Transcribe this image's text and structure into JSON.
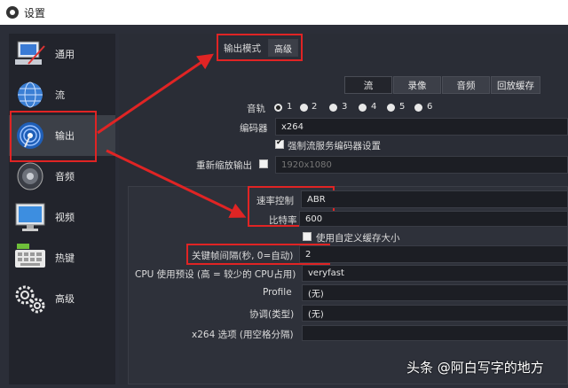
{
  "window": {
    "title": "设置"
  },
  "sidebar": {
    "items": [
      {
        "label": "通用",
        "icon": "general-icon"
      },
      {
        "label": "流",
        "icon": "stream-globe-icon"
      },
      {
        "label": "输出",
        "icon": "output-icon"
      },
      {
        "label": "音频",
        "icon": "speaker-icon"
      },
      {
        "label": "视频",
        "icon": "monitor-icon"
      },
      {
        "label": "热键",
        "icon": "keyboard-icon"
      },
      {
        "label": "高级",
        "icon": "gears-icon"
      }
    ],
    "active": "输出"
  },
  "output_mode": {
    "label": "输出模式",
    "value": "高级"
  },
  "tabs": [
    {
      "label": "流",
      "active": true
    },
    {
      "label": "录像",
      "active": false
    },
    {
      "label": "音频",
      "active": false
    },
    {
      "label": "回放缓存",
      "active": false
    }
  ],
  "audio_track": {
    "label": "音轨",
    "options": [
      "1",
      "2",
      "3",
      "4",
      "5",
      "6"
    ],
    "selected": "1"
  },
  "encoder": {
    "label": "编码器",
    "value": "x264"
  },
  "enforce_service_settings": {
    "label": "强制流服务编码器设置",
    "checked": true
  },
  "rescale_output": {
    "label": "重新缩放输出",
    "checked": false,
    "value": "1920x1080"
  },
  "rate_control": {
    "label": "速率控制",
    "value": "ABR"
  },
  "bitrate": {
    "label": "比特率",
    "value": "600"
  },
  "custom_buffer": {
    "label": "使用自定义缓存大小",
    "checked": false
  },
  "keyframe_interval": {
    "label": "关键帧间隔(秒, 0=自动)",
    "value": "2"
  },
  "cpu_preset": {
    "label": "CPU 使用预设 (高 = 较少的 CPU占用)",
    "value": "veryfast"
  },
  "profile": {
    "label": "Profile",
    "value": "(无)"
  },
  "tune": {
    "label": "协调(类型)",
    "value": "(无)"
  },
  "x264_options": {
    "label": "x264 选项 (用空格分隔)",
    "value": ""
  },
  "watermark": {
    "text": "头条 @阿白写字的地方"
  },
  "colors": {
    "annotation_red": "#e02424",
    "bg": "#2b2e38",
    "field_bg": "#1c1e24"
  }
}
